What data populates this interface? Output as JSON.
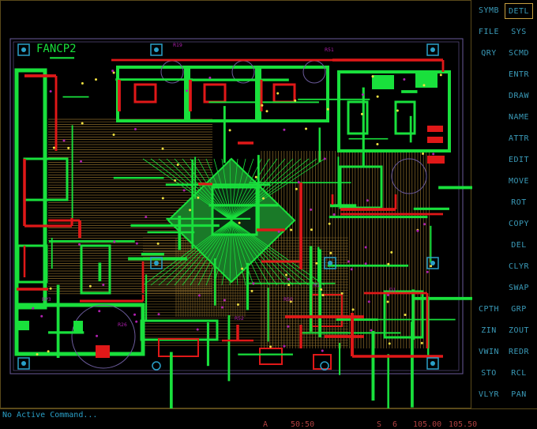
{
  "board": {
    "title": "FANCP2",
    "colors": {
      "top_copper": "#19e03c",
      "bottom_copper": "#e01818",
      "trace_tan": "#8a6a2a",
      "silk": "#b020b0",
      "outline": "#6a5a9a",
      "pad": "#f0e040",
      "cyan": "#2aa0c8"
    },
    "labels": [
      "R51",
      "R19",
      "R26",
      "R50",
      "R52",
      "D1",
      "R1",
      "RP3"
    ]
  },
  "menu": {
    "items": [
      {
        "label": "SYMB",
        "active": false
      },
      {
        "label": "DETL",
        "active": true
      },
      {
        "label": "FILE",
        "active": false
      },
      {
        "label": "SYS",
        "active": false
      },
      {
        "label": "QRY",
        "active": false
      },
      {
        "label": "SCMD",
        "active": false
      },
      {
        "label": "",
        "active": false
      },
      {
        "label": "ENTR",
        "active": false
      },
      {
        "label": "",
        "active": false
      },
      {
        "label": "DRAW",
        "active": false
      },
      {
        "label": "",
        "active": false
      },
      {
        "label": "NAME",
        "active": false
      },
      {
        "label": "",
        "active": false
      },
      {
        "label": "ATTR",
        "active": false
      },
      {
        "label": "",
        "active": false
      },
      {
        "label": "EDIT",
        "active": false
      },
      {
        "label": "",
        "active": false
      },
      {
        "label": "MOVE",
        "active": false
      },
      {
        "label": "",
        "active": false
      },
      {
        "label": "ROT",
        "active": false
      },
      {
        "label": "",
        "active": false
      },
      {
        "label": "COPY",
        "active": false
      },
      {
        "label": "",
        "active": false
      },
      {
        "label": "DEL",
        "active": false
      },
      {
        "label": "",
        "active": false
      },
      {
        "label": "CLYR",
        "active": false
      },
      {
        "label": "",
        "active": false
      },
      {
        "label": "SWAP",
        "active": false
      },
      {
        "label": "CPTH",
        "active": false
      },
      {
        "label": "GRP",
        "active": false
      },
      {
        "label": "ZIN",
        "active": false
      },
      {
        "label": "ZOUT",
        "active": false
      },
      {
        "label": "VWIN",
        "active": false
      },
      {
        "label": "REDR",
        "active": false
      },
      {
        "label": "STO",
        "active": false
      },
      {
        "label": "RCL",
        "active": false
      },
      {
        "label": "VLYR",
        "active": false
      },
      {
        "label": "PAN",
        "active": false
      }
    ]
  },
  "status": {
    "message": "No Active Command...",
    "layer_code": "A",
    "grid": "50:50",
    "snap": "S",
    "layer_num": "6",
    "coord_x": "105.00",
    "coord_y": "105.50"
  }
}
